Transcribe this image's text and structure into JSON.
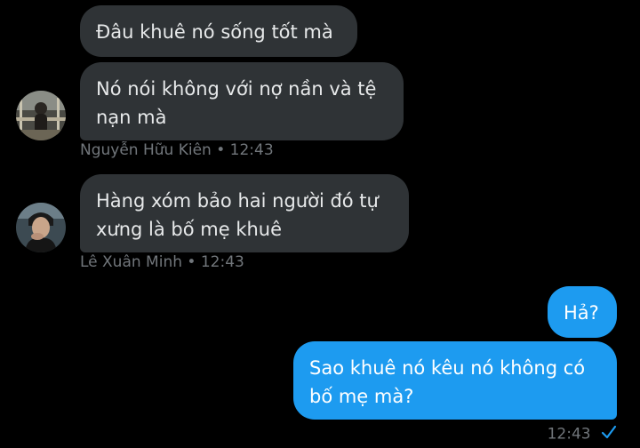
{
  "conversation": {
    "messages": [
      {
        "text": "Đâu khuê nó sống tốt mà",
        "direction": "incoming"
      },
      {
        "text": "Nó nói không với nợ nần và tệ nạn mà",
        "direction": "incoming"
      },
      {
        "text": "Hàng xóm bảo hai người đó tự xưng là bố mẹ khuê",
        "direction": "incoming"
      },
      {
        "text": "Hả?",
        "direction": "outgoing"
      },
      {
        "text": "Sao khuê nó kêu nó không có bố mẹ mà?",
        "direction": "outgoing"
      }
    ],
    "sender_meta": [
      {
        "name": "Nguyễn Hữu Kiên",
        "separator": "•",
        "time": "12:43"
      },
      {
        "name": "Lê Xuân Minh",
        "separator": "•",
        "time": "12:43"
      }
    ],
    "outgoing_meta": {
      "time": "12:43",
      "status_icon": "checkmark-icon"
    }
  },
  "colors": {
    "background": "#000000",
    "incoming_bubble": "#2f3336",
    "outgoing_bubble": "#1d9bf0",
    "meta_text": "#71767b"
  }
}
